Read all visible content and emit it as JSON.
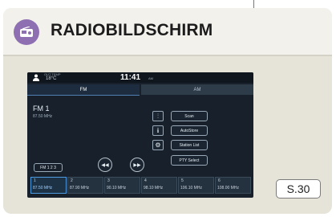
{
  "header": {
    "title": "RADIOBILDSCHIRM",
    "icon": "radio-icon",
    "icon_color": "#8e6fb2"
  },
  "screen": {
    "status_bar": {
      "outside_temp_label": "OUT TEMP",
      "outside_temp_value": "18°C",
      "time": "11:41",
      "ampm": "AM"
    },
    "tabs": [
      {
        "label": "FM",
        "active": true
      },
      {
        "label": "AM",
        "active": false
      }
    ],
    "station": {
      "name": "FM 1",
      "frequency": "87.50 MHz"
    },
    "icon_buttons": [
      {
        "icon": "equalizer-icon",
        "glyph": "⫶"
      },
      {
        "icon": "info-icon",
        "glyph": "i"
      },
      {
        "icon": "settings-gear-icon",
        "glyph": "⚙"
      }
    ],
    "side_buttons": {
      "scan": "Scan",
      "autostore": "AutoStore",
      "station_list": "Station List",
      "pty_select": "PTY Select"
    },
    "fm_band_select": "FM 1 2 3",
    "seek_back_glyph": "◀◀",
    "seek_forward_glyph": "▶▶",
    "presets": [
      {
        "number": "1",
        "frequency": "87.50 MHz",
        "active": true
      },
      {
        "number": "2",
        "frequency": "87.90 MHz",
        "active": false
      },
      {
        "number": "3",
        "frequency": "90.10 MHz",
        "active": false
      },
      {
        "number": "4",
        "frequency": "98.10 MHz",
        "active": false
      },
      {
        "number": "5",
        "frequency": "106.10 MHz",
        "active": false
      },
      {
        "number": "6",
        "frequency": "108.00 MHz",
        "active": false
      }
    ]
  },
  "page_ref": "S.30"
}
